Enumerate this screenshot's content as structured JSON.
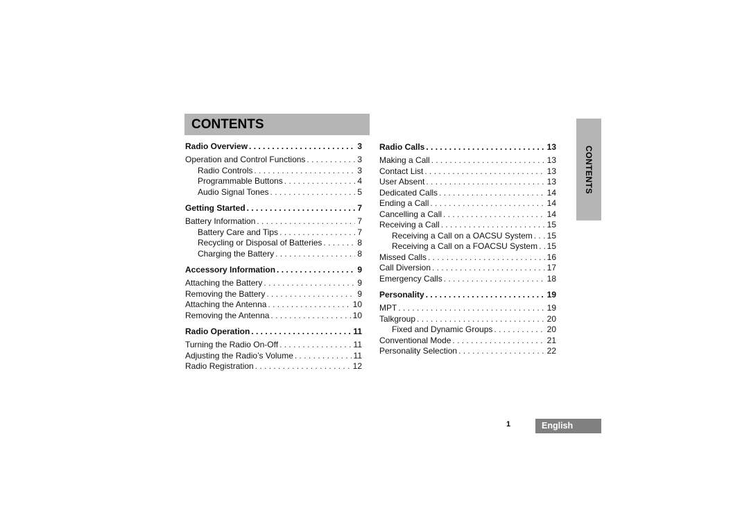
{
  "header": {
    "title": "CONTENTS"
  },
  "side_tab": {
    "label": "CONTENTS"
  },
  "footer": {
    "page_number": "1",
    "language": "English"
  },
  "colors": {
    "header_bg": "#b5b5b5",
    "language_bg": "#808080"
  },
  "left_column": [
    {
      "title": "Radio Overview",
      "page": "3",
      "level": "section"
    },
    {
      "title": "Operation and Control Functions",
      "page": "3",
      "level": "entry"
    },
    {
      "title": "Radio Controls",
      "page": "3",
      "level": "sub"
    },
    {
      "title": "Programmable Buttons",
      "page": "4",
      "level": "sub"
    },
    {
      "title": "Audio Signal Tones",
      "page": "5",
      "level": "sub"
    },
    {
      "title": "Getting Started",
      "page": "7",
      "level": "section"
    },
    {
      "title": "Battery Information",
      "page": "7",
      "level": "entry"
    },
    {
      "title": "Battery Care and Tips",
      "page": "7",
      "level": "sub"
    },
    {
      "title": "Recycling or Disposal of Batteries",
      "page": "8",
      "level": "sub"
    },
    {
      "title": "Charging the Battery",
      "page": "8",
      "level": "sub"
    },
    {
      "title": "Accessory Information",
      "page": "9",
      "level": "section"
    },
    {
      "title": "Attaching the Battery",
      "page": "9",
      "level": "entry"
    },
    {
      "title": "Removing the Battery",
      "page": "9",
      "level": "entry"
    },
    {
      "title": "Attaching the Antenna",
      "page": "10",
      "level": "entry"
    },
    {
      "title": "Removing the Antenna",
      "page": "10",
      "level": "entry"
    },
    {
      "title": "Radio Operation",
      "page": "11",
      "level": "section"
    },
    {
      "title": "Turning the Radio On-Off",
      "page": "11",
      "level": "entry"
    },
    {
      "title": "Adjusting the Radio’s Volume",
      "page": "11",
      "level": "entry"
    },
    {
      "title": "Radio Registration",
      "page": "12",
      "level": "entry"
    }
  ],
  "right_column": [
    {
      "title": "Radio Calls",
      "page": "13",
      "level": "section"
    },
    {
      "title": "Making a Call",
      "page": "13",
      "level": "entry"
    },
    {
      "title": "Contact List",
      "page": "13",
      "level": "entry"
    },
    {
      "title": "User Absent",
      "page": "13",
      "level": "entry"
    },
    {
      "title": "Dedicated Calls",
      "page": "14",
      "level": "entry"
    },
    {
      "title": "Ending a Call",
      "page": "14",
      "level": "entry"
    },
    {
      "title": "Cancelling a Call",
      "page": "14",
      "level": "entry"
    },
    {
      "title": "Receiving a Call",
      "page": "15",
      "level": "entry"
    },
    {
      "title": "Receiving a Call on a OACSU System",
      "page": "15",
      "level": "sub"
    },
    {
      "title": "Receiving a Call on a FOACSU System",
      "page": "15",
      "level": "sub"
    },
    {
      "title": "Missed Calls",
      "page": "16",
      "level": "entry"
    },
    {
      "title": "Call Diversion",
      "page": "17",
      "level": "entry"
    },
    {
      "title": "Emergency Calls",
      "page": "18",
      "level": "entry"
    },
    {
      "title": "Personality",
      "page": "19",
      "level": "section"
    },
    {
      "title": "MPT",
      "page": "19",
      "level": "entry"
    },
    {
      "title": "Talkgroup",
      "page": "20",
      "level": "entry"
    },
    {
      "title": "Fixed and Dynamic Groups",
      "page": "20",
      "level": "sub"
    },
    {
      "title": "Conventional Mode",
      "page": "21",
      "level": "entry"
    },
    {
      "title": "Personality Selection",
      "page": "22",
      "level": "entry"
    }
  ]
}
